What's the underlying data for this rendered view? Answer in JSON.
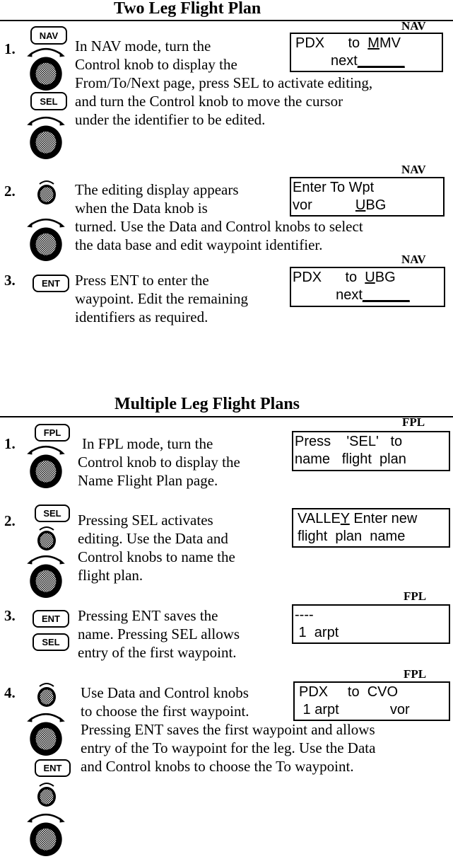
{
  "section1": {
    "title": "Two Leg Flight Plan",
    "steps": [
      {
        "number": "1.",
        "buttons": [
          "NAV",
          "SEL"
        ],
        "lines": [
          "In NAV mode, turn the",
          "Control knob to display the",
          "From/To/Next page, press SEL to activate editing,",
          "and turn the Control knob to move the cursor",
          "under the identifier to be edited."
        ],
        "display": {
          "mode": "NAV",
          "line1": {
            "from": "PDX",
            "to_word": "to",
            "cursor_char": "M",
            "rest": "MV"
          },
          "line2": {
            "label": "next",
            "blank": "______"
          }
        }
      },
      {
        "number": "2.",
        "lines": [
          "The editing display appears",
          "when the Data knob is",
          "turned.  Use the Data and Control knobs to select",
          "the data base and edit waypoint identifier."
        ],
        "display": {
          "mode": "NAV",
          "line1": "Enter To Wpt",
          "line2": {
            "db": "vor",
            "cursor_char": "U",
            "rest": "BG"
          }
        }
      },
      {
        "number": "3.",
        "buttons": [
          "ENT"
        ],
        "lines": [
          "Press ENT to enter the",
          "waypoint. Edit the remaining",
          "identifiers as required."
        ],
        "display": {
          "mode": "NAV",
          "line1": {
            "from": "PDX",
            "to_word": "to",
            "cursor_char": "U",
            "rest": "BG"
          },
          "line2": {
            "label": "next",
            "blank": "______"
          }
        }
      }
    ]
  },
  "section2": {
    "title": "Multiple Leg Flight Plans",
    "steps": [
      {
        "number": "1.",
        "buttons": [
          "FPL"
        ],
        "lines": [
          "In FPL mode, turn the",
          "Control knob to display the",
          "Name Flight Plan page."
        ],
        "display": {
          "mode": "FPL",
          "line1": "Press    'SEL'   to",
          "line2": "name   flight  plan"
        }
      },
      {
        "number": "2.",
        "buttons": [
          "SEL"
        ],
        "lines": [
          "Pressing SEL activates",
          "editing. Use the Data and",
          "Control knobs to name the",
          "flight plan."
        ],
        "display": {
          "mode": "",
          "line1": {
            "name": "VALLE",
            "cursor_char": "Y",
            "rest": " Enter new"
          },
          "line2": "flight  plan  name"
        }
      },
      {
        "number": "3.",
        "buttons": [
          "ENT",
          "SEL"
        ],
        "lines": [
          "Pressing ENT saves the",
          "name. Pressing SEL allows",
          "entry of the first waypoint."
        ],
        "display": {
          "mode": "FPL",
          "line1": "----",
          "line2": " 1  arpt"
        }
      },
      {
        "number": "4.",
        "buttons": [
          "ENT"
        ],
        "lines": [
          "Use  Data and Control knobs",
          "to choose the first waypoint.",
          "Pressing ENT saves the first waypoint and allows",
          "entry of the To waypoint for the leg. Use the Data",
          "and Control knobs to choose the To waypoint."
        ],
        "display": {
          "mode": "FPL",
          "line1": "PDX     to  CVO",
          "line2": " 1 arpt             vor"
        }
      }
    ]
  },
  "icons": {
    "control_knob": "large-knob-with-rotation-arrow",
    "data_knob": "small-knob-with-rotation-arrow"
  }
}
